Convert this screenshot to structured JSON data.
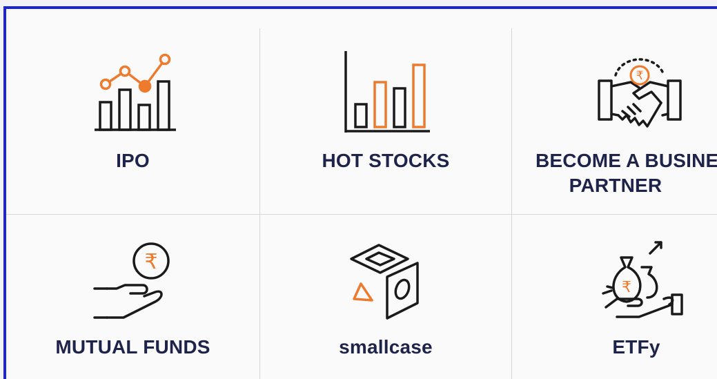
{
  "tiles": [
    {
      "label": "IPO",
      "icon": "ipo-chart-icon"
    },
    {
      "label": "HOT STOCKS",
      "icon": "bar-chart-icon"
    },
    {
      "label_line1": "BECOME A BUSINESS",
      "label_line2": "PARTNER",
      "icon": "handshake-rupee-icon"
    },
    {
      "label": "MUTUAL FUNDS",
      "icon": "hand-rupee-coin-icon"
    },
    {
      "label": "smallcase",
      "icon": "smallcase-cube-icon"
    },
    {
      "label": "ETFy",
      "icon": "money-bags-hand-icon"
    }
  ],
  "colors": {
    "accent": "#ee7a2e",
    "ink": "#1a1a1a",
    "label": "#1e2349",
    "frame": "#1c25d6"
  }
}
